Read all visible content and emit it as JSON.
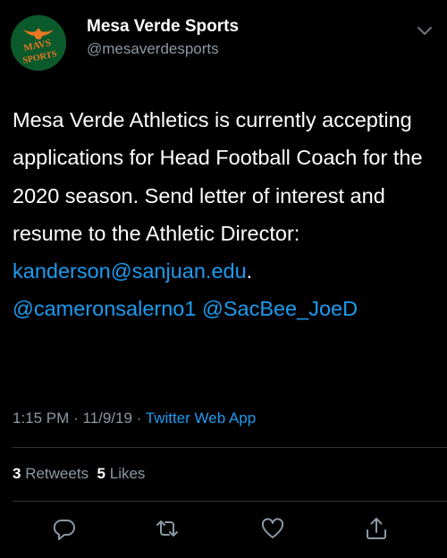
{
  "author": {
    "display_name": "Mesa Verde Sports",
    "handle": "@mesaverdesports",
    "avatar_text_line1": "MAVS",
    "avatar_text_line2": "SPORTS"
  },
  "tweet": {
    "text": "Mesa Verde Athletics is currently accepting applications for Head Football Coach for the 2020 season. Send letter of interest and resume to the Athletic Director:",
    "email_link": "kanderson@sanjuan.edu",
    "trailing_period": ".",
    "mention_1": "@cameronsalerno1",
    "mention_2": "@SacBee_JoeD"
  },
  "meta": {
    "time": "1:15 PM",
    "separator": "·",
    "date": "11/9/19",
    "source": "Twitter Web App"
  },
  "stats": {
    "retweets_count": "3",
    "retweets_label": "Retweets",
    "likes_count": "5",
    "likes_label": "Likes"
  },
  "icons": {
    "reply": "reply-icon",
    "retweet": "retweet-icon",
    "like": "heart-icon",
    "share": "share-icon",
    "menu": "chevron-down-icon"
  },
  "colors": {
    "background": "#000000",
    "link": "#1d9bf0",
    "secondary_text": "#8b98a5",
    "avatar_green": "#0b5a2b",
    "avatar_orange": "#e87722"
  }
}
